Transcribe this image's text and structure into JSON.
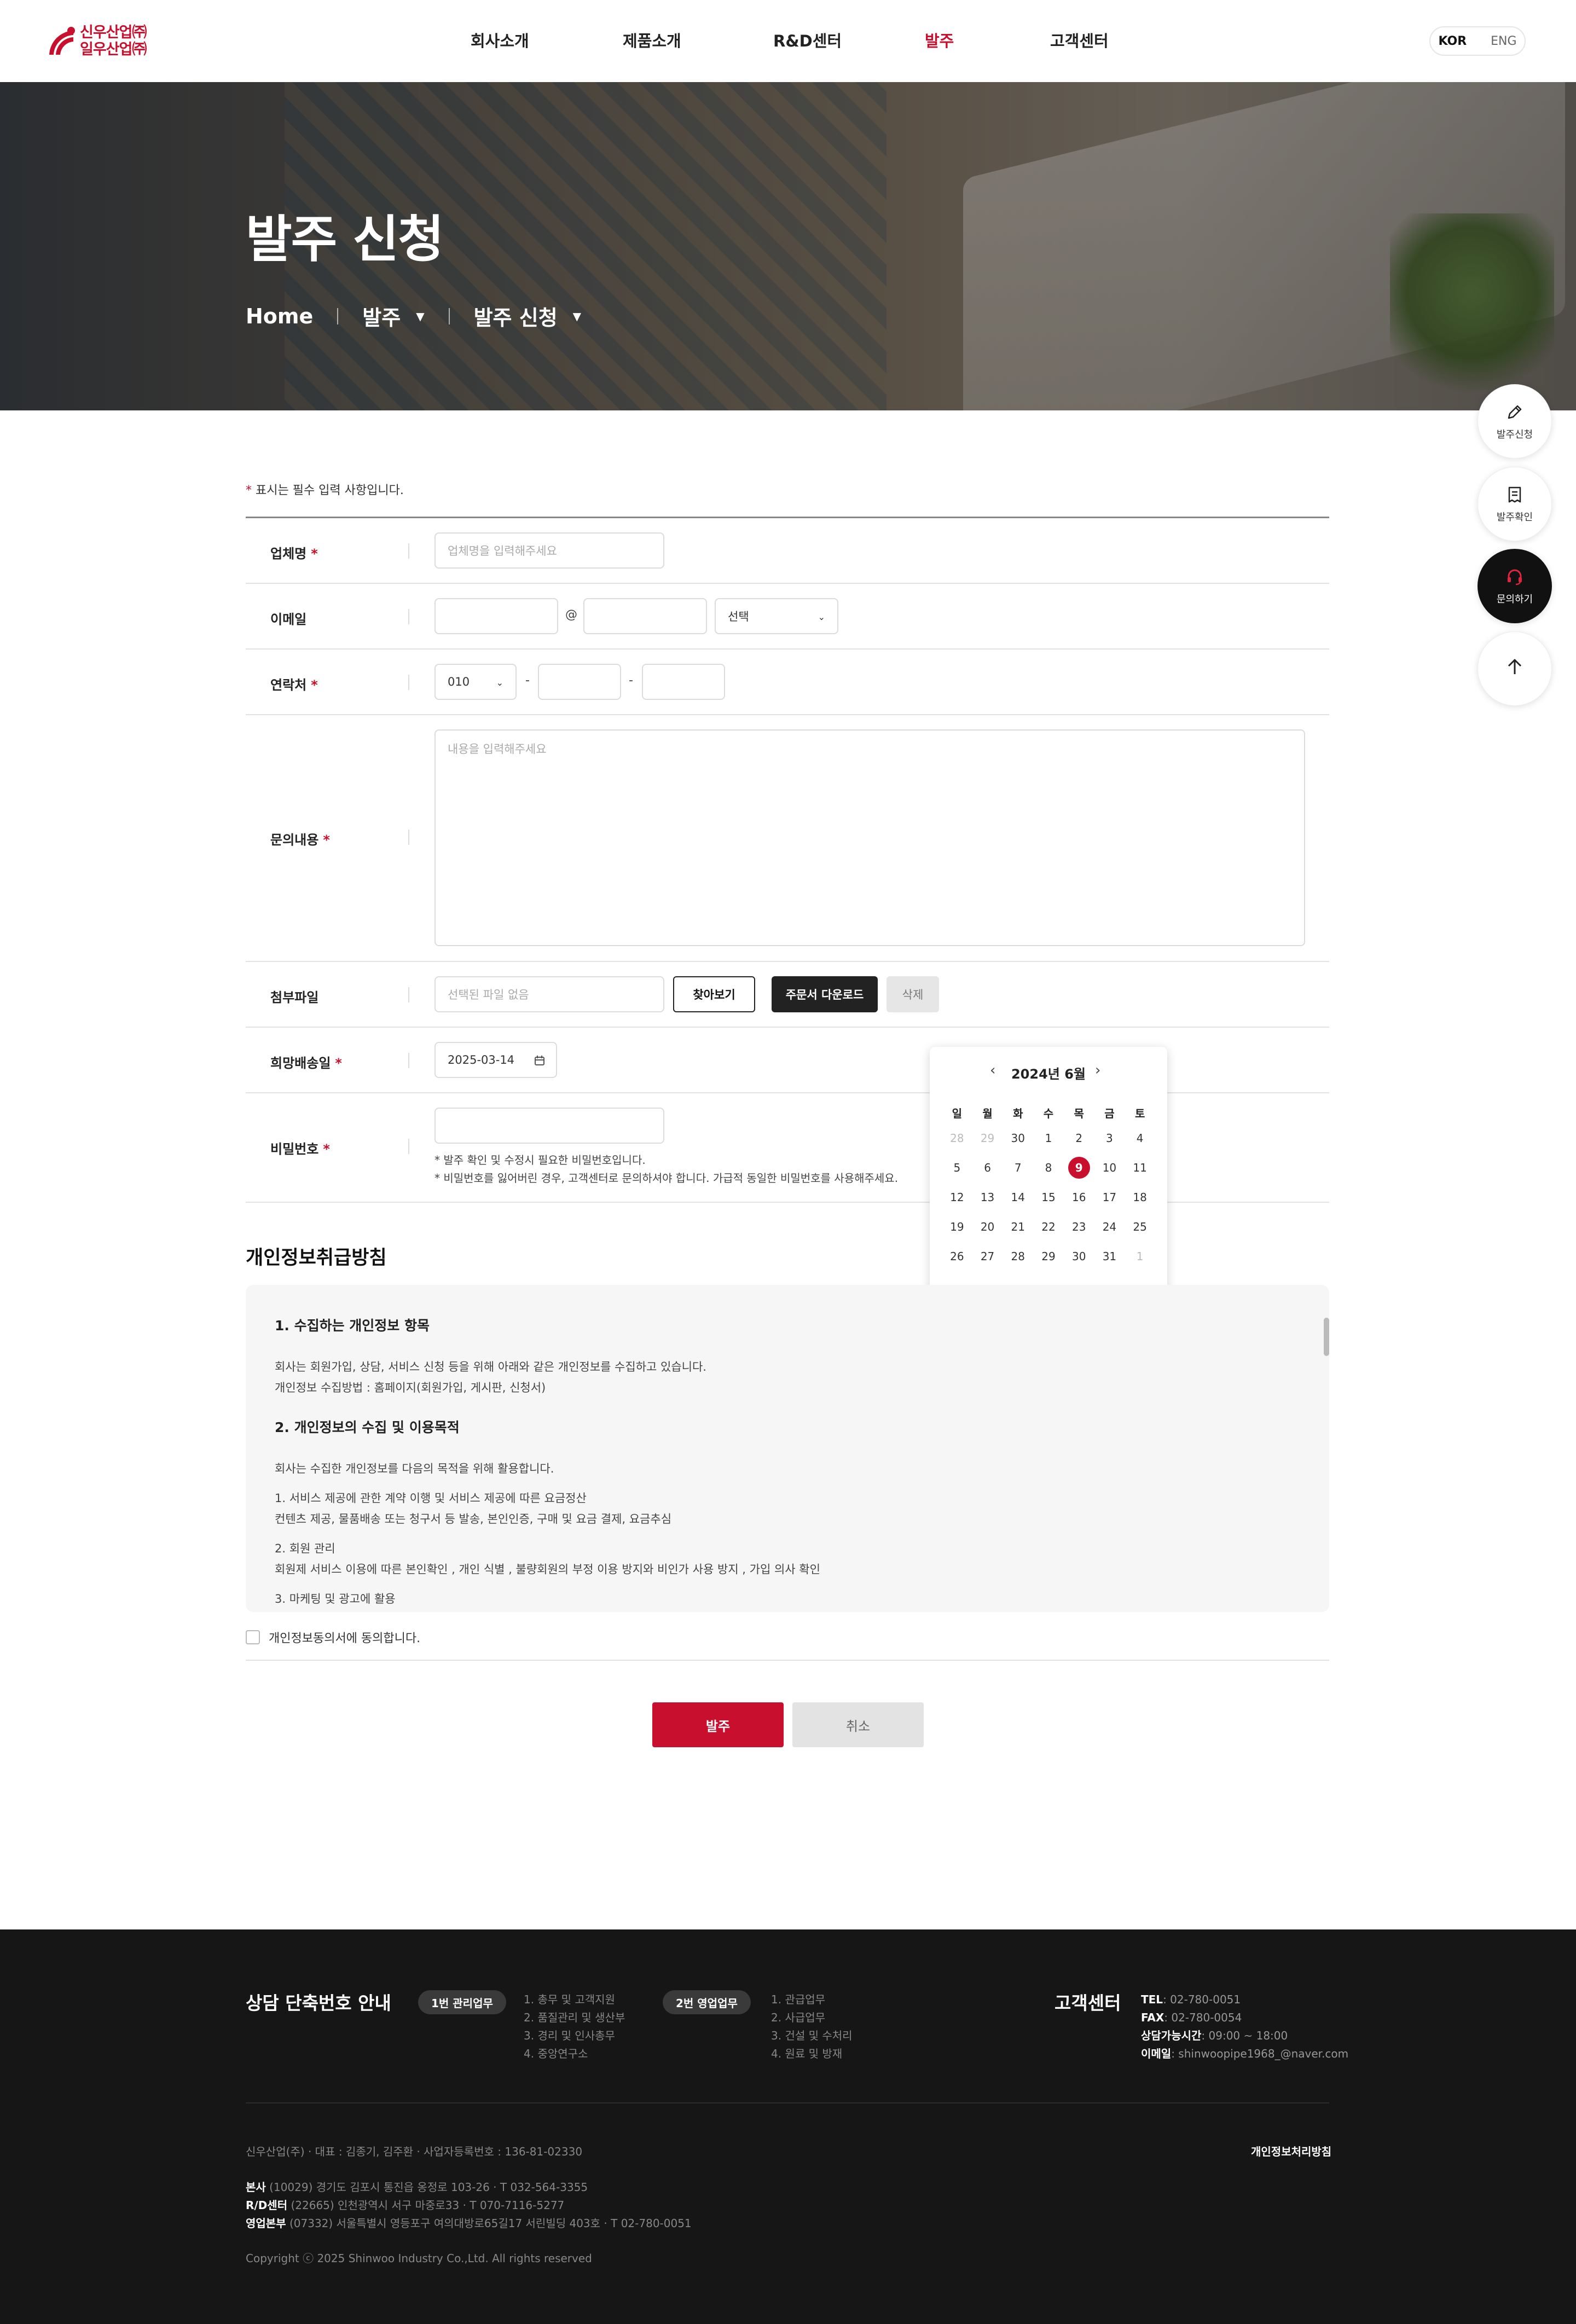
{
  "header": {
    "logo": {
      "line1": "신우산업㈜",
      "line2": "일우산업㈜"
    },
    "nav": [
      {
        "label": "회사소개"
      },
      {
        "label": "제품소개"
      },
      {
        "label": "R&D센터"
      },
      {
        "label": "발주",
        "active": true
      },
      {
        "label": "고객센터"
      }
    ],
    "lang": {
      "kor": "KOR",
      "eng": "ENG"
    }
  },
  "hero": {
    "title": "발주 신청",
    "breadcrumb": {
      "home": "Home",
      "level1": "발주",
      "level2": "발주 신청"
    }
  },
  "form": {
    "required_note_star": "*",
    "required_note": " 표시는 필수 입력 사항입니다.",
    "company": {
      "label": "업체명",
      "placeholder": "업체명을 입력해주세요"
    },
    "email": {
      "label": "이메일",
      "at": "@",
      "domain_select": "선택"
    },
    "phone": {
      "label": "연락처",
      "prefix": "010",
      "dash": "-"
    },
    "content": {
      "label": "문의내용",
      "placeholder": "내용을 입력해주세요"
    },
    "file": {
      "label": "첨부파일",
      "placeholder": "선택된 파일 없음",
      "browse": "찾아보기",
      "download": "주문서 다운로드",
      "delete": "삭제"
    },
    "delivery": {
      "label": "희망배송일",
      "value": "2025-03-14"
    },
    "password": {
      "label": "비밀번호",
      "note1": "* 발주 확인 및 수정시 필요한 비밀번호입니다.",
      "note2": "* 비밀번호를 잃어버린 경우, 고객센터로 문의하셔야 합니다. 가급적 동일한 비밀번호를 사용해주세요."
    }
  },
  "calendar": {
    "title": "2024년 6월",
    "weekdays": [
      "일",
      "월",
      "화",
      "수",
      "목",
      "금",
      "토"
    ],
    "days": [
      [
        "28",
        "29",
        "30",
        "1",
        "2",
        "3",
        "4"
      ],
      [
        "5",
        "6",
        "7",
        "8",
        "9",
        "10",
        "11"
      ],
      [
        "12",
        "13",
        "14",
        "15",
        "16",
        "17",
        "18"
      ],
      [
        "19",
        "20",
        "21",
        "22",
        "23",
        "24",
        "25"
      ],
      [
        "26",
        "27",
        "28",
        "29",
        "30",
        "31",
        "1"
      ]
    ],
    "selected": "9"
  },
  "privacy": {
    "title": "개인정보취급방침",
    "s1_title": "1. 수집하는 개인정보 항목",
    "s1_p1": "회사는 회원가입, 상담, 서비스 신청 등을 위해 아래와 같은 개인정보를 수집하고 있습니다.",
    "s1_p2": "개인정보 수집방법 : 홈페이지(회원가입, 게시판, 신청서)",
    "s2_title": "2. 개인정보의 수집 및 이용목적",
    "s2_p1": "회사는 수집한 개인정보를 다음의 목적을 위해 활용합니다.",
    "s2_p2": "1. 서비스 제공에 관한 계약 이행 및 서비스 제공에 따른 요금정산",
    "s2_p3": "컨텐츠 제공, 물품배송 또는 청구서 등 발송, 본인인증, 구매 및 요금 결제, 요금추심",
    "s2_p4": "2. 회원 관리",
    "s2_p5": "회원제 서비스 이용에 따른 본인확인 , 개인 식별 , 불량회원의 부정 이용 방지와 비인가 사용 방지 , 가입 의사 확인",
    "s2_p6": "3. 마케팅 및 광고에 활용",
    "agree": "개인정보동의서에 동의합니다."
  },
  "actions": {
    "submit": "발주",
    "cancel": "취소"
  },
  "quick_menu": [
    {
      "label": "발주신청",
      "icon": "pencil-icon"
    },
    {
      "label": "발주확인",
      "icon": "receipt-icon"
    },
    {
      "label": "문의하기",
      "icon": "headset-icon"
    },
    {
      "label": "",
      "icon": "arrow-up-icon"
    }
  ],
  "footer": {
    "title": "상담 단축번호 안내",
    "group1": {
      "pill": "1번 관리업무",
      "items": [
        "1. 총무 및 고객지원",
        "2. 품질관리 및 생산부",
        "3. 경리 및 인사총무",
        "4. 중앙연구소"
      ]
    },
    "group2": {
      "pill": "2번 영업업무",
      "items": [
        "1. 관급업무",
        "2. 사급업무",
        "3. 건설 및 수처리",
        "4. 원료 및 방재"
      ]
    },
    "cs_title": "고객센터",
    "tel_label": "TEL",
    "tel": ": 02-780-0051",
    "fax_label": "FAX",
    "fax": ": 02-780-0054",
    "hours_label": "상담가능시간",
    "hours": ": 09:00 ~ 18:00",
    "email_label": "이메일",
    "email": ": shinwoopipe1968_@naver.com",
    "company_info": "신우산업(주) · 대표 : 김종기, 김주환 · 사업자등록번호 : 136-81-02330",
    "privacy_link": "개인정보처리방침",
    "hq_label": "본사",
    "hq": " (10029) 경기도 김포시 통진읍 옹정로 103-26 · T 032-564-3355",
    "rd_label": "R/D센터",
    "rd": " (22665) 인천광역시 서구 마중로33 · T 070-7116-5277",
    "sales_label": "영업본부",
    "sales": " (07332) 서울특별시 영등포구 여의대방로65길17 서린빌딩 403호 · T 02-780-0051",
    "copyright": "Copyright ⓒ 2025 Shinwoo Industry Co.,Ltd. All rights reserved"
  },
  "colors": {
    "accent": "#c8102e",
    "dark": "#222222",
    "footer_bg": "#161616"
  }
}
